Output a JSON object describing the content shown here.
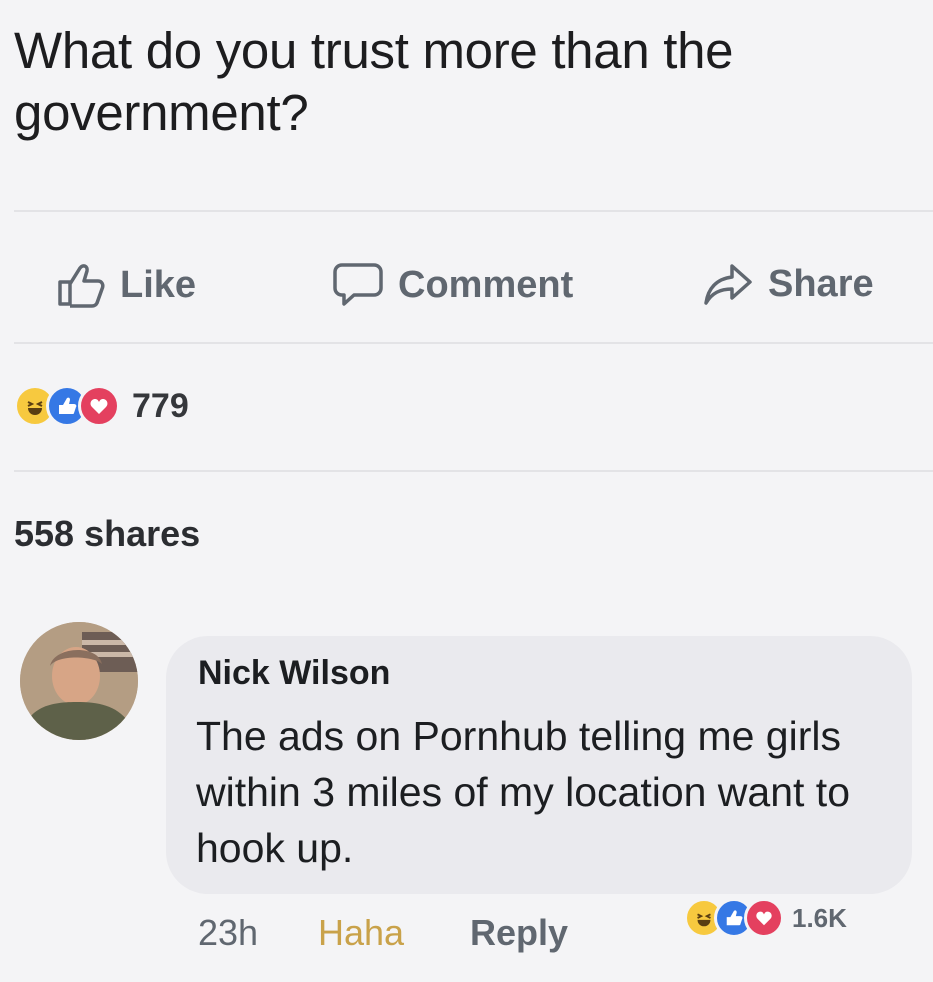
{
  "post": {
    "text": "What do you trust more than the government?"
  },
  "actions": {
    "like": "Like",
    "comment": "Comment",
    "share": "Share"
  },
  "reactions": {
    "icons": [
      "haha-icon",
      "like-icon",
      "love-icon"
    ],
    "count": "779"
  },
  "shares": "558 shares",
  "comment": {
    "author": "Nick Wilson",
    "text": "The ads on Pornhub telling me girls within 3 miles of my location want to hook up.",
    "time": "23h",
    "haha_label": "Haha",
    "reply_label": "Reply",
    "reaction_count": "1.6K"
  },
  "colors": {
    "like_blue": "#3578e5",
    "love_red": "#e4405f",
    "haha_yellow": "#f7c93f",
    "muted_gray": "#606770"
  }
}
